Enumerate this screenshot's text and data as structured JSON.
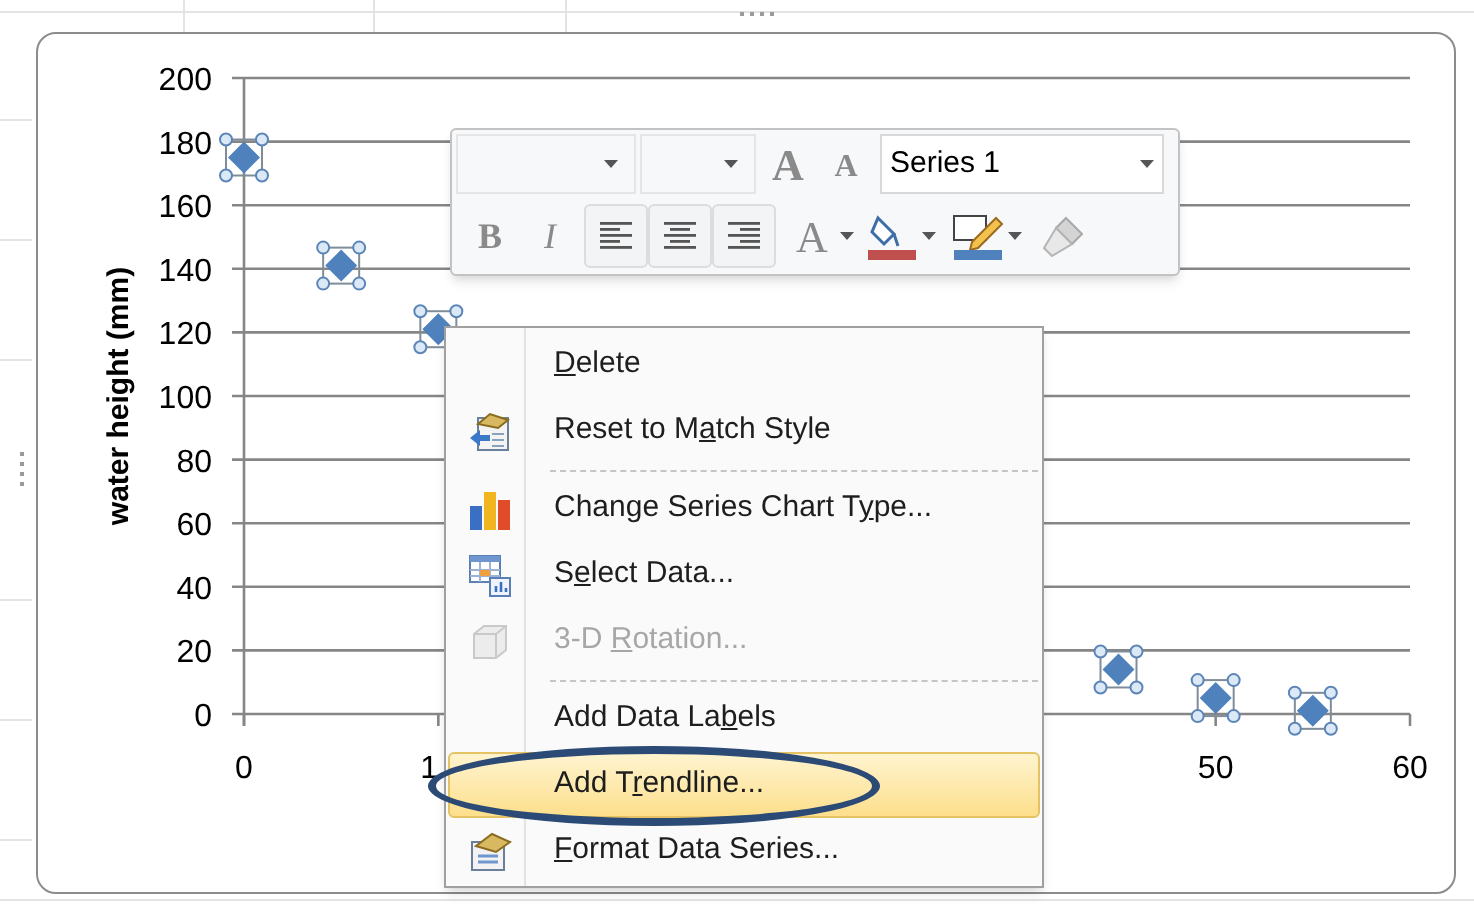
{
  "chart": {
    "series_selected": true,
    "x_tick_label_partly_hidden": "1",
    "chart_data": {
      "type": "scatter",
      "ylabel": "water height (mm)",
      "x": [
        0,
        5,
        10,
        45,
        50,
        55
      ],
      "series": [
        {
          "color": "#4f81bd",
          "values": [
            175,
            141,
            121,
            14,
            5,
            1
          ]
        }
      ],
      "grid": true,
      "xlim": [
        0,
        60
      ],
      "ylim": [
        0,
        200
      ],
      "xticks": [
        0,
        50,
        60
      ],
      "yticks": [
        0,
        20,
        40,
        60,
        80,
        100,
        120,
        140,
        160,
        180,
        200
      ]
    }
  },
  "mini_toolbar": {
    "series_box": {
      "value": "Series 1"
    },
    "grow_font": "A",
    "shrink_font": "A",
    "bold": "B",
    "italic": "I",
    "font_color": "A"
  },
  "context_menu": [
    {
      "kind": "item",
      "key": "D",
      "after": "elete",
      "disabled": false,
      "selected": false,
      "circled": false
    },
    {
      "kind": "item",
      "before": "Reset to M",
      "key": "a",
      "after": "tch Style",
      "disabled": false,
      "selected": false,
      "circled": false
    },
    {
      "kind": "separator"
    },
    {
      "kind": "item",
      "before": "Change Series Chart T",
      "key": "y",
      "after": "pe...",
      "disabled": false,
      "selected": false,
      "circled": false
    },
    {
      "kind": "item",
      "before": "S",
      "key": "e",
      "after": "lect Data...",
      "disabled": false,
      "selected": false,
      "circled": false
    },
    {
      "kind": "item",
      "before": "3-D ",
      "key": "R",
      "after": "otation...",
      "disabled": true,
      "selected": false,
      "circled": false
    },
    {
      "kind": "separator"
    },
    {
      "kind": "item",
      "before": "Add Data La",
      "key": "b",
      "after": "els",
      "disabled": false,
      "selected": false,
      "circled": false
    },
    {
      "kind": "item",
      "before": "Add T",
      "key": "r",
      "after": "endline...",
      "disabled": false,
      "selected": true,
      "circled": true
    },
    {
      "kind": "item",
      "key": "F",
      "after": "ormat Data Series...",
      "disabled": false,
      "selected": false,
      "circled": false
    }
  ]
}
